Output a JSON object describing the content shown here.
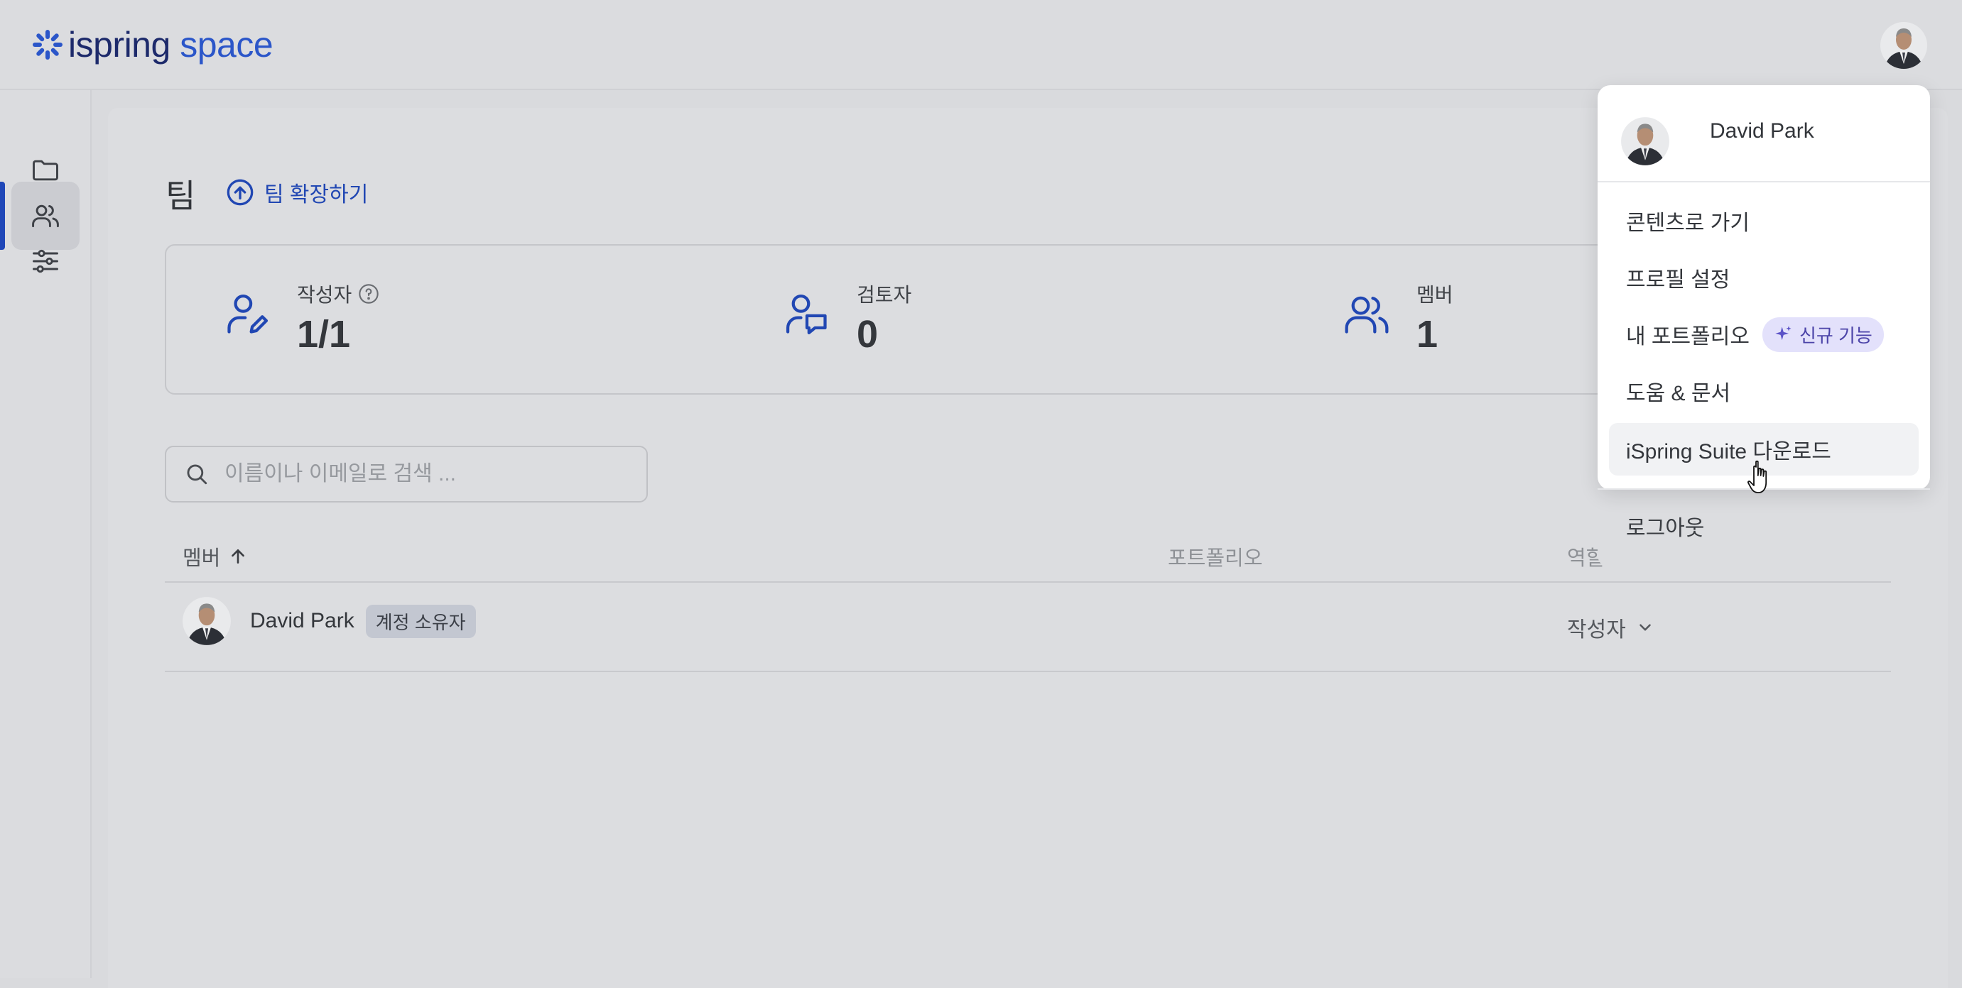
{
  "app": {
    "logo_part1": "ispring",
    "logo_part2": "space"
  },
  "sidebar": {
    "items": [
      {
        "name": "folder-icon"
      },
      {
        "name": "users-icon",
        "active": true
      },
      {
        "name": "sliders-icon"
      }
    ]
  },
  "page": {
    "title": "팀",
    "expand_link": "팀 확장하기"
  },
  "stats": [
    {
      "label": "작성자",
      "value": "1/1",
      "has_help": true
    },
    {
      "label": "검토자",
      "value": "0"
    },
    {
      "label": "멤버",
      "value": "1"
    }
  ],
  "search": {
    "placeholder": "이름이나 이메일로 검색 ..."
  },
  "table": {
    "columns": {
      "member": "멤버",
      "portfolio": "포트폴리오",
      "role": "역할"
    },
    "rows": [
      {
        "name": "David Park",
        "badge": "계정 소유자",
        "role": "작성자"
      }
    ]
  },
  "user_menu": {
    "user_name": "David Park",
    "items": {
      "content": "콘텐츠로 가기",
      "profile": "프로필 설정",
      "portfolio": "내 포트폴리오",
      "new_badge": "신규 기능",
      "help": "도움 & 문서",
      "download": "iSpring Suite 다운로드",
      "logout": "로그아웃"
    }
  },
  "colors": {
    "accent": "#1f47b8",
    "link": "#2147b3",
    "new_badge_bg": "#e3e1fb"
  }
}
